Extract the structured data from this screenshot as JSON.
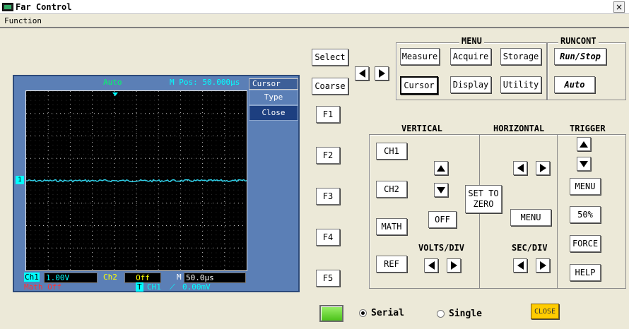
{
  "window": {
    "title": "Far Control",
    "close_glyph": "×"
  },
  "menubar": {
    "items": [
      "Function"
    ]
  },
  "scope": {
    "trigger_mode": "Auto",
    "mpos": "M Pos: 50.000μs",
    "menu_header": "Cursor",
    "menu_items": [
      "Type",
      "Close"
    ],
    "ch1_label": "Ch1",
    "ch1_value": "1.00V",
    "ch2_label": "Ch2",
    "ch2_value": "Off",
    "m_label": "M",
    "m_value": "50.0μs",
    "math": "Math Off",
    "trig_badge": "T",
    "trig_source": "CH1",
    "trig_level": "0.00mV",
    "channel_marker": "1",
    "colors": {
      "trace": "#2fd0e8",
      "ch1": "#00ffff",
      "ch2": "#ffff00",
      "math": "#ff3333"
    }
  },
  "left_buttons": {
    "select": "Select",
    "coarse": "Coarse",
    "f": [
      "F1",
      "F2",
      "F3",
      "F4",
      "F5"
    ]
  },
  "menu_group": {
    "title": "MENU",
    "buttons": [
      "Measure",
      "Acquire",
      "Storage",
      "Cursor",
      "Display",
      "Utility"
    ]
  },
  "runcont_group": {
    "title": "RUNCONT",
    "run_stop": "Run/Stop",
    "auto": "Auto"
  },
  "vertical": {
    "title": "VERTICAL",
    "ch1": "CH1",
    "ch2": "CH2",
    "math": "MATH",
    "ref": "REF",
    "off": "OFF",
    "volts_div": "VOLTS/DIV"
  },
  "set_to_zero": "SET TO ZERO",
  "horizontal": {
    "title": "HORIZONTAL",
    "menu": "MENU",
    "sec_div": "SEC/DIV"
  },
  "trigger": {
    "title": "TRIGGER",
    "menu": "MENU",
    "fifty": "50%",
    "force": "FORCE",
    "help": "HELP"
  },
  "bottom": {
    "serial": "Serial",
    "single": "Single",
    "close": "CLOSE"
  }
}
